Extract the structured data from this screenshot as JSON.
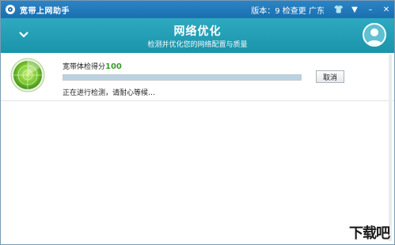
{
  "titlebar": {
    "app_title": "宽带上网助手",
    "version": "版本：9 检查更 广东",
    "buttons": {
      "skin": "👕",
      "menu": "▼",
      "minimize": "–",
      "close": "✕"
    }
  },
  "header": {
    "title": "网络优化",
    "subtitle": "检测并优化您的网络配置与质量"
  },
  "scan": {
    "score_label": "宽带体检得分",
    "score_value": "100",
    "progress_percent": 100,
    "status": "正在进行检测，请耐心等候…",
    "cancel_label": "取消"
  },
  "watermark": "下载吧",
  "colors": {
    "titlebar": "#1b6fb0",
    "header": "#1b94ab",
    "score_green": "#3a9c2b"
  }
}
